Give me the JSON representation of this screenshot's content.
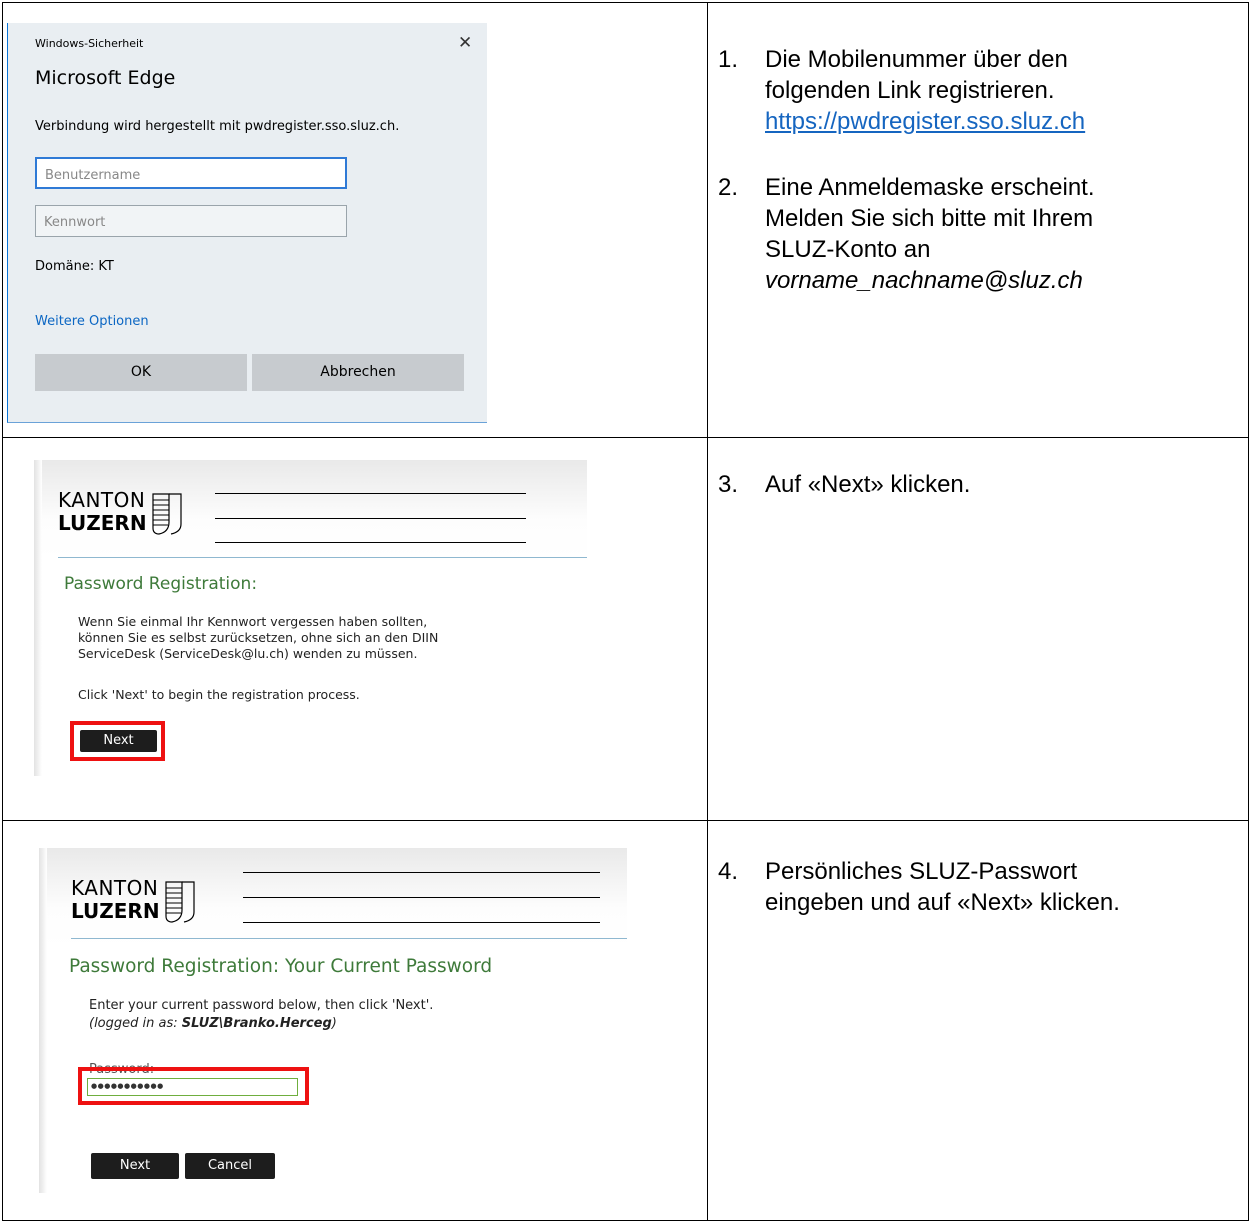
{
  "windows_dialog": {
    "security_title": "Windows-Sicherheit",
    "close_glyph": "✕",
    "app_name": "Microsoft Edge",
    "connection_text": "Verbindung wird hergestellt mit pwdregister.sso.sluz.ch.",
    "username_placeholder": "Benutzername",
    "password_placeholder": "Kennwort",
    "domain_text": "Domäne: KT",
    "more_options": "Weitere Optionen",
    "ok_label": "OK",
    "cancel_label": "Abbrechen"
  },
  "steps": [
    {
      "number": "1.",
      "lines": [
        "Die Mobilenummer über den",
        "folgenden Link registrieren."
      ],
      "link": "https://pwdregister.sso.sluz.ch"
    },
    {
      "number": "2.",
      "lines": [
        "Eine Anmeldemaske erscheint.",
        "Melden Sie sich bitte mit Ihrem",
        "SLUZ-Konto an"
      ],
      "italic": "vorname_nachname@sluz.ch"
    },
    {
      "number": "3.",
      "lines": [
        "Auf «Next» klicken."
      ]
    },
    {
      "number": "4.",
      "lines": [
        "Persönliches SLUZ-Passwort",
        "eingeben und auf «Next» klicken."
      ]
    }
  ],
  "logo": {
    "kanton": "KANTON",
    "luzern": "LUZERN"
  },
  "registration": {
    "heading": "Password Registration:",
    "intro_lines": [
      "Wenn Sie einmal Ihr Kennwort vergessen haben sollten,",
      "können Sie es selbst zurücksetzen, ohne sich an den DIIN",
      "ServiceDesk (ServiceDesk@lu.ch) wenden zu müssen."
    ],
    "instruction": "Click 'Next' to begin the registration process.",
    "next_label": "Next"
  },
  "current_password": {
    "heading": "Password Registration:  Your Current Password",
    "instruction": "Enter your current password below, then click 'Next'.",
    "logged_in_prefix": "(logged in as: ",
    "logged_in_user": "SLUZ\\Branko.Herceg",
    "logged_in_suffix": ")",
    "password_label": "Password:",
    "password_value": "●●●●●●●●●●●",
    "next_label": "Next",
    "cancel_label": "Cancel"
  },
  "colors": {
    "highlight_red": "#ee1111",
    "heading_green": "#3e7a3a",
    "link_blue": "#1565c0"
  }
}
